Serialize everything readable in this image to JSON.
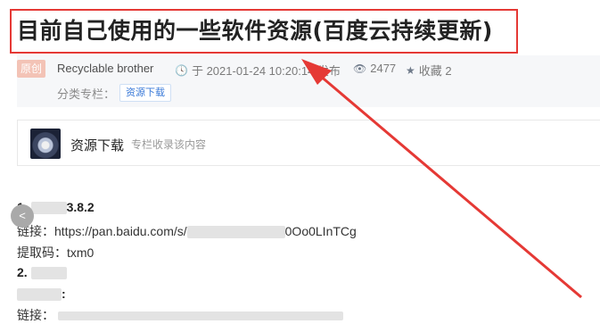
{
  "article": {
    "title": "目前自己使用的一些软件资源(百度云持续更新)",
    "badge": "原创",
    "author": "Recyclable brother",
    "date": "于 2021-01-24 10:20:14 发布",
    "views": "2477",
    "favorites": "收藏 2",
    "column_label": "分类专栏：",
    "column_tag": "资源下载"
  },
  "collection": {
    "name": "资源下载",
    "desc": "专栏收录该内容"
  },
  "content": {
    "item1_num": "1.",
    "item1_version": "3.8.2",
    "link_label": "链接：",
    "link_prefix": "https://pan.baidu.com/s/",
    "link_suffix": "0Oo0LInTCg",
    "code_label": "提取码：",
    "code_value": "txm0",
    "item2_num": "2.",
    "colon": ":",
    "link_label2": "链接："
  },
  "icons": {
    "clock": "clock-icon",
    "eye": "eye-icon",
    "star": "star-icon",
    "prev": "chevron-left-icon"
  },
  "colors": {
    "highlight": "#e53935",
    "tag_blue": "#3a7ad8"
  }
}
